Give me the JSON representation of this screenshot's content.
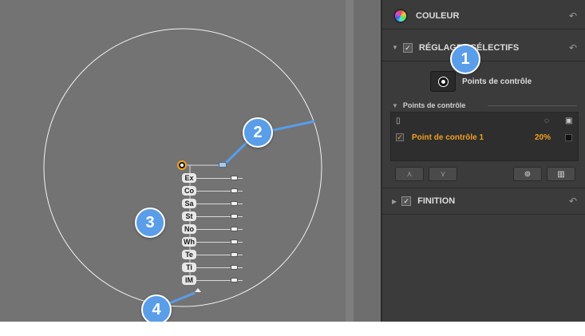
{
  "panel": {
    "couleur": {
      "title": "COULEUR",
      "undo_icon": "undo-arrow-icon",
      "icon": "color-wheel-icon"
    },
    "reglages": {
      "title": "RÉGLAGES SÉLECTIFS",
      "checked": "✓",
      "undo_icon": "undo-arrow-icon"
    },
    "control_point_button": {
      "label": "Points de contrôle"
    },
    "control_points": {
      "title": "Points de contrôle",
      "rows": [
        {
          "checked": "✓",
          "name": "Point de contrôle 1",
          "opacity": "20%"
        }
      ]
    },
    "finition": {
      "title": "FINITION",
      "checked": "✓",
      "undo_icon": "undo-arrow-icon"
    }
  },
  "canvas": {
    "sliders": [
      {
        "label": "Ex",
        "level": 0.35
      },
      {
        "label": "Co",
        "level": 0.35
      },
      {
        "label": "Sa",
        "level": 0.35
      },
      {
        "label": "St",
        "level": 0.35
      },
      {
        "label": "No",
        "level": 0.35
      },
      {
        "label": "Wh",
        "level": 0.35
      },
      {
        "label": "Te",
        "level": 0.35
      },
      {
        "label": "Ti",
        "level": 0.35
      },
      {
        "label": "IM",
        "level": 0.35
      }
    ]
  },
  "callouts": [
    "1",
    "2",
    "3",
    "4"
  ],
  "colors": {
    "accent": "#f0a020",
    "callout": "#5a9de8",
    "panel_bg": "#3b3b3b",
    "canvas_bg": "#737373"
  }
}
